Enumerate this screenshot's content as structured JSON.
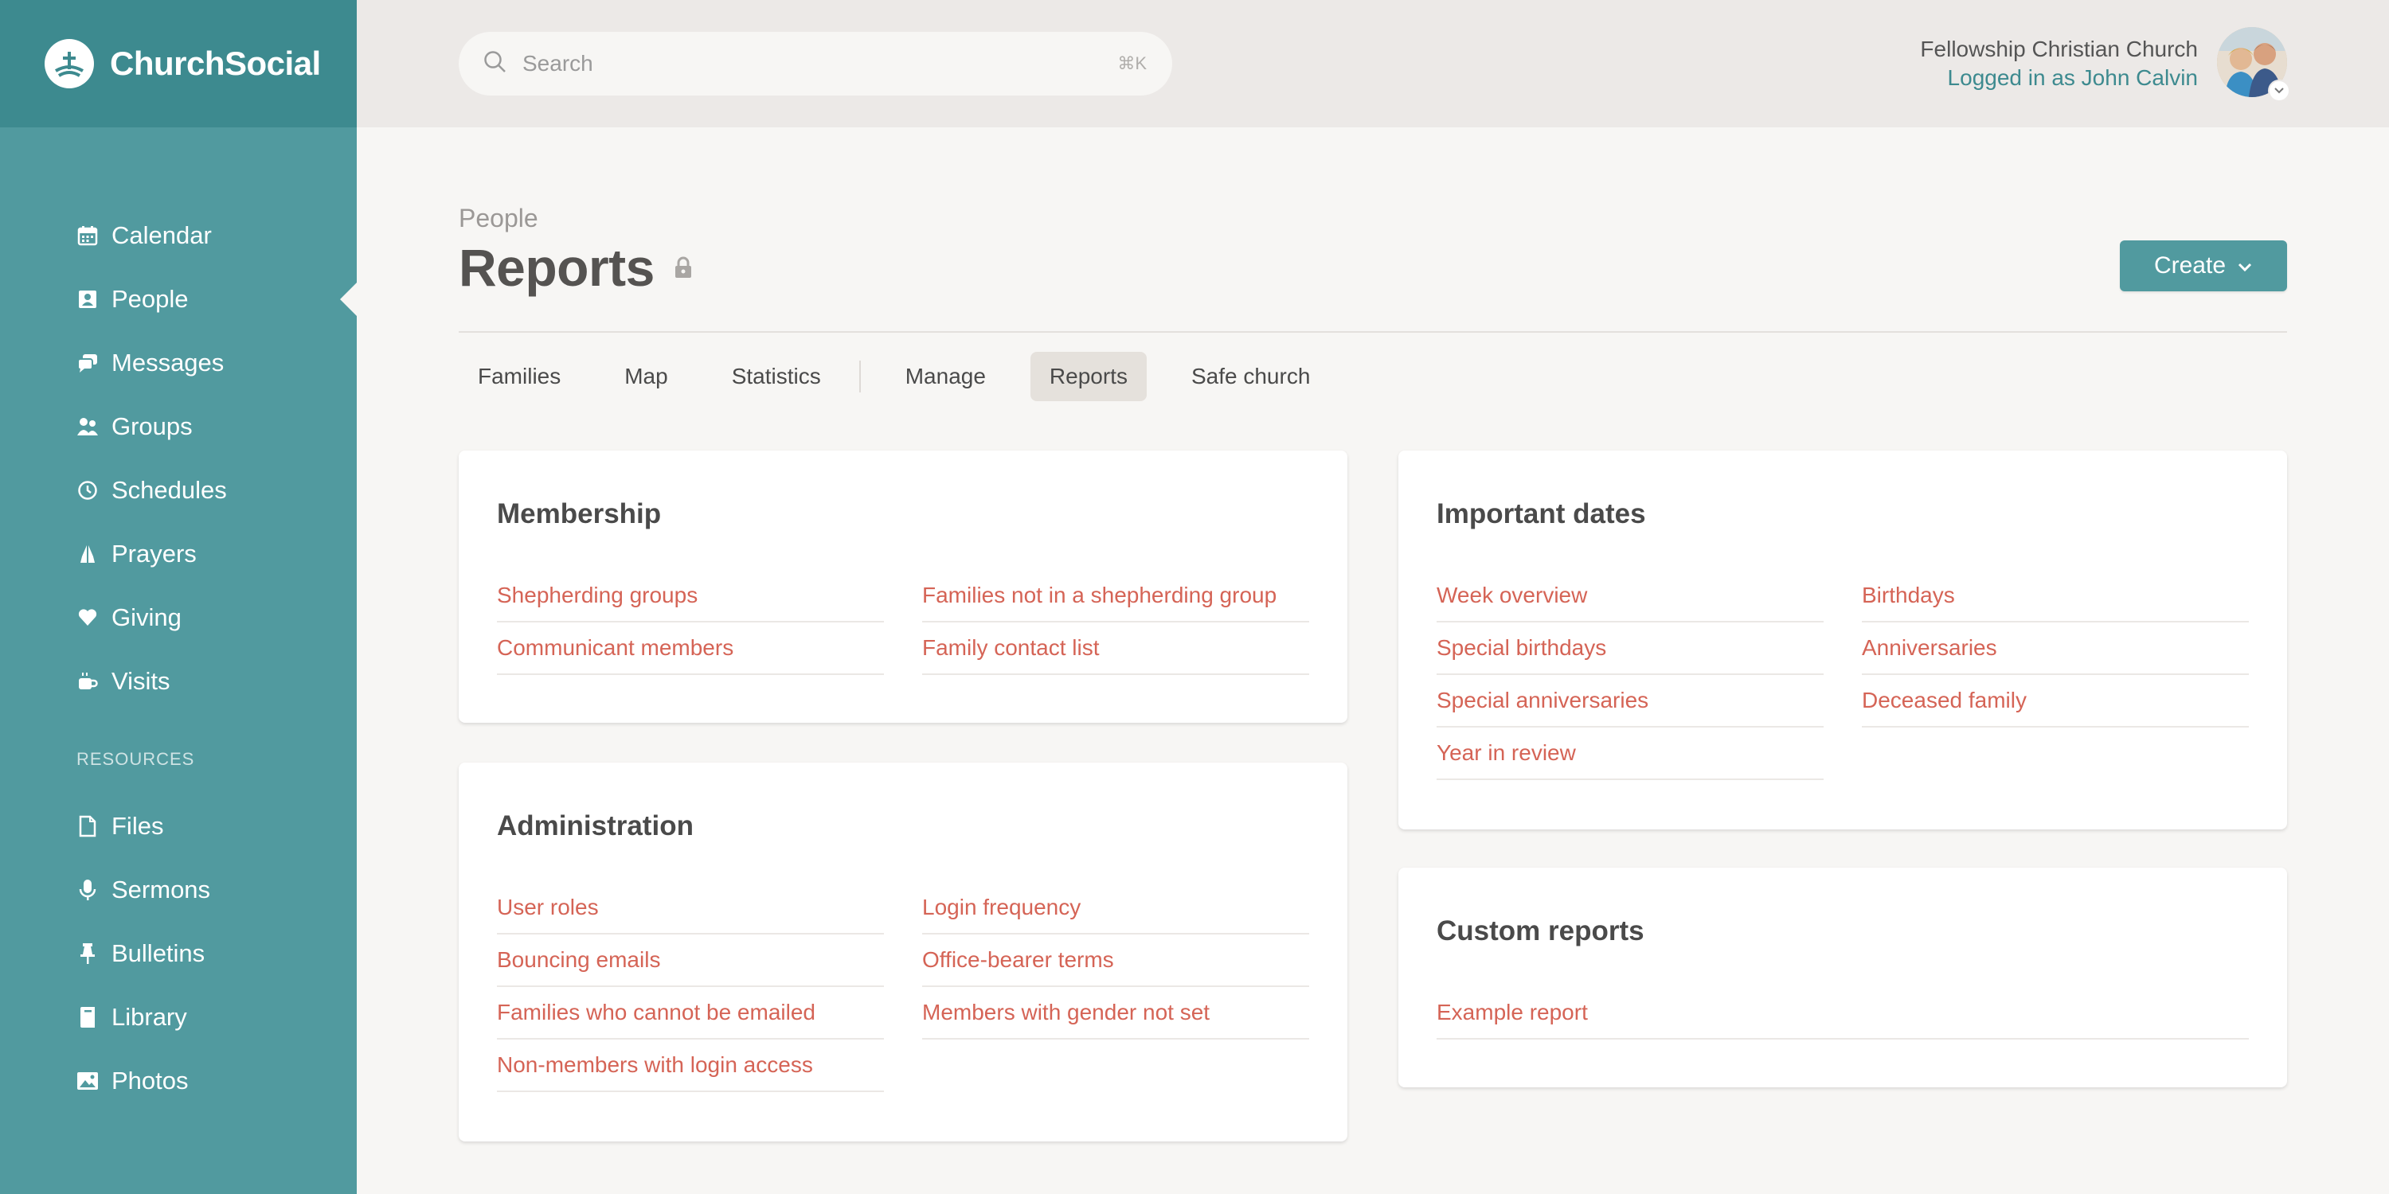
{
  "brand": {
    "name": "ChurchSocial"
  },
  "sidebar": {
    "items": [
      {
        "label": "Calendar",
        "icon": "calendar-icon"
      },
      {
        "label": "People",
        "icon": "person-card-icon",
        "active": true
      },
      {
        "label": "Messages",
        "icon": "messages-icon"
      },
      {
        "label": "Groups",
        "icon": "groups-icon"
      },
      {
        "label": "Schedules",
        "icon": "clock-icon"
      },
      {
        "label": "Prayers",
        "icon": "praying-hands-icon"
      },
      {
        "label": "Giving",
        "icon": "heart-icon"
      },
      {
        "label": "Visits",
        "icon": "coffee-cup-icon"
      }
    ],
    "resources_label": "RESOURCES",
    "resources": [
      {
        "label": "Files",
        "icon": "file-icon"
      },
      {
        "label": "Sermons",
        "icon": "microphone-icon"
      },
      {
        "label": "Bulletins",
        "icon": "pin-icon"
      },
      {
        "label": "Library",
        "icon": "book-icon"
      },
      {
        "label": "Photos",
        "icon": "image-icon"
      }
    ]
  },
  "topbar": {
    "search_placeholder": "Search",
    "search_shortcut": "⌘K",
    "org_name": "Fellowship Christian Church",
    "user_text": "Logged in as John Calvin"
  },
  "page": {
    "breadcrumb": "People",
    "title": "Reports",
    "create_label": "Create"
  },
  "tabs": [
    {
      "label": "Families"
    },
    {
      "label": "Map"
    },
    {
      "label": "Statistics"
    },
    {
      "label": "Manage"
    },
    {
      "label": "Reports",
      "active": true
    },
    {
      "label": "Safe church"
    }
  ],
  "cards": {
    "membership": {
      "title": "Membership",
      "col1": [
        "Shepherding groups",
        "Communicant members"
      ],
      "col2": [
        "Families not in a shepherding group",
        "Family contact list"
      ]
    },
    "administration": {
      "title": "Administration",
      "col1": [
        "User roles",
        "Bouncing emails",
        "Families who cannot be emailed",
        "Non-members with login access"
      ],
      "col2": [
        "Login frequency",
        "Office-bearer terms",
        "Members with gender not set"
      ]
    },
    "important_dates": {
      "title": "Important dates",
      "col1": [
        "Week overview",
        "Special birthdays",
        "Special anniversaries",
        "Year in review"
      ],
      "col2": [
        "Birthdays",
        "Anniversaries",
        "Deceased family"
      ]
    },
    "custom_reports": {
      "title": "Custom reports",
      "col1": [
        "Example report"
      ]
    }
  },
  "colors": {
    "sidebar": "#519a9f",
    "brand_bar": "#3d8a8f",
    "link": "#d56456",
    "accent": "#519a9f"
  }
}
